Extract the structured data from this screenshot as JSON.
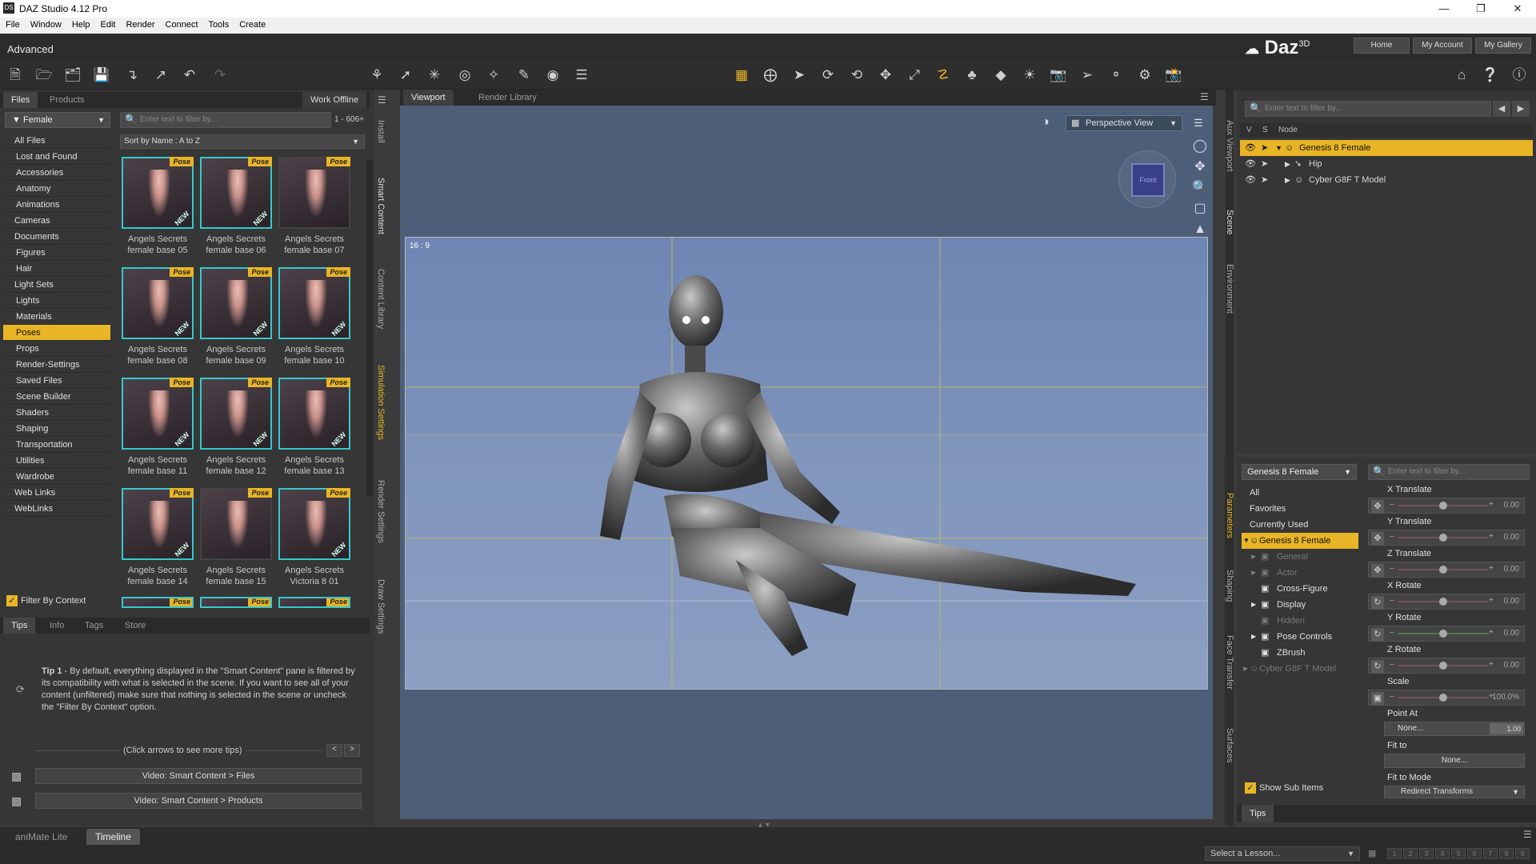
{
  "window": {
    "title": "DAZ Studio 4.12 Pro",
    "logo": "DS"
  },
  "menu": [
    "File",
    "Window",
    "Help",
    "Edit",
    "Render",
    "Connect",
    "Tools",
    "Create"
  ],
  "layout": {
    "name": "Advanced",
    "brand": "Daz",
    "brand_sup": "3D",
    "links": [
      "Home",
      "My Account",
      "My Gallery"
    ]
  },
  "left": {
    "tabs": [
      "Files",
      "Products"
    ],
    "work_offline": "Work Offline",
    "filter": "Female",
    "search_placeholder": "Enter text to filter by...",
    "count": "1 - 606+",
    "sort": "Sort by Name : A to Z",
    "categories": [
      "All Files",
      "Lost and Found",
      "Accessories",
      "Anatomy",
      "Animations",
      "Cameras",
      "Documents",
      "Figures",
      "Hair",
      "Light Sets",
      "Lights",
      "Materials",
      "Poses",
      "Props",
      "Render-Settings",
      "Saved Files",
      "Scene Builder",
      "Shaders",
      "Shaping",
      "Transportation",
      "Utilities",
      "Wardrobe",
      "Web Links",
      "WebLinks"
    ],
    "selected_category": "Poses",
    "items": [
      {
        "l1": "Angels Secrets",
        "l2": "female base 05"
      },
      {
        "l1": "Angels Secrets",
        "l2": "female base 06"
      },
      {
        "l1": "Angels Secrets",
        "l2": "female base 07"
      },
      {
        "l1": "Angels Secrets",
        "l2": "female base 08"
      },
      {
        "l1": "Angels Secrets",
        "l2": "female base 09"
      },
      {
        "l1": "Angels Secrets",
        "l2": "female base 10"
      },
      {
        "l1": "Angels Secrets",
        "l2": "female base 11"
      },
      {
        "l1": "Angels Secrets",
        "l2": "female base 12"
      },
      {
        "l1": "Angels Secrets",
        "l2": "female base 13"
      },
      {
        "l1": "Angels Secrets",
        "l2": "female base 14"
      },
      {
        "l1": "Angels Secrets",
        "l2": "female base 15"
      },
      {
        "l1": "Angels Secrets",
        "l2": "Victoria 8 01"
      }
    ],
    "pose_badge": "Pose",
    "new_badge": "NEW",
    "filter_context": "Filter By Context",
    "side_tabs": [
      "Install",
      "Smart Content",
      "Content Library",
      "Simulation Settings",
      "Render Settings",
      "Draw Settings"
    ],
    "active_side_tab": "Smart Content",
    "tips_tabs": [
      "Tips",
      "Info",
      "Tags",
      "Store"
    ],
    "tip_title": "Tip 1",
    "tip_text": " - By default, everything displayed in the \"Smart Content\" pane is filtered by its compatibility with what is selected in the scene. If you want to see all of your content (unfiltered) make sure that nothing is selected in the scene or uncheck the \"Filter By Context\" option.",
    "tip_hint": "(Click arrows to see more tips)",
    "videos": [
      "Video: Smart Content > Files",
      "Video: Smart Content > Products"
    ]
  },
  "viewport": {
    "tabs": [
      "Viewport",
      "Render Library"
    ],
    "view": "Perspective View",
    "ratio": "16 : 9",
    "cube_label": "Front"
  },
  "scene": {
    "search_placeholder": "Enter text to filter by...",
    "cols": [
      "V",
      "S",
      "Node"
    ],
    "nodes": [
      "Genesis 8 Female",
      "Hip",
      "Cyber G8F T Model"
    ],
    "side_tabs": [
      "Aux Viewport",
      "Scene",
      "Environment"
    ]
  },
  "params": {
    "node": "Genesis 8 Female",
    "search_placeholder": "Enter text to filter by...",
    "groups": [
      "All",
      "Favorites",
      "Currently Used",
      "Genesis 8 Female",
      "General",
      "Actor",
      "Cross-Figure",
      "Display",
      "Hidden",
      "Pose Controls",
      "ZBrush",
      "Cyber G8F T Model"
    ],
    "sliders": [
      {
        "label": "X Translate",
        "value": "0.00"
      },
      {
        "label": "Y Translate",
        "value": "0.00"
      },
      {
        "label": "Z Translate",
        "value": "0.00"
      },
      {
        "label": "X Rotate",
        "value": "0.00"
      },
      {
        "label": "Y Rotate",
        "value": "0.00"
      },
      {
        "label": "Z Rotate",
        "value": "0.00"
      },
      {
        "label": "Scale",
        "value": "100.0%"
      }
    ],
    "point_at": {
      "label": "Point At",
      "value": "None...",
      "num": "1.00"
    },
    "fit_to": {
      "label": "Fit to",
      "value": "None..."
    },
    "fit_mode": {
      "label": "Fit to Mode",
      "value": "Redirect Transforms"
    },
    "show_sub": "Show Sub Items",
    "tips": "Tips",
    "side_tabs": [
      "Parameters",
      "Shaping",
      "Face Transfer",
      "Surfaces"
    ]
  },
  "bottom": {
    "tabs": [
      "aniMate Lite",
      "Timeline"
    ],
    "active": "Timeline",
    "lesson": "Select a Lesson...",
    "steps": [
      "1",
      "2",
      "3",
      "4",
      "5",
      "6",
      "7",
      "8",
      "9"
    ]
  },
  "colors": {
    "accent": "#e8b526",
    "thumb_border": "#38c7cc"
  }
}
